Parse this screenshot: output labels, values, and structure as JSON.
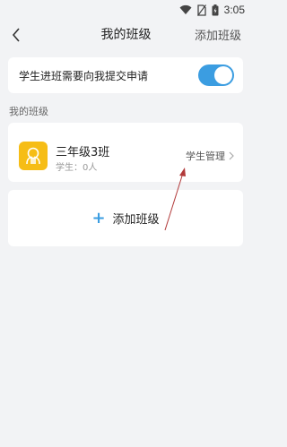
{
  "status_bar": {
    "time": "3:05",
    "icons": [
      "wifi-icon",
      "no-sim-icon",
      "battery-icon"
    ]
  },
  "header": {
    "title": "我的班级",
    "action_label": "添加班级",
    "back_icon": "chevron-left-icon"
  },
  "settings": {
    "join_approval_label": "学生进班需要向我提交申请",
    "join_approval_enabled": true
  },
  "section": {
    "title": "我的班级"
  },
  "classes": [
    {
      "name": "三年级3班",
      "student_count": "学生：0人",
      "manage_label": "学生管理",
      "avatar_icon": "class-logo-icon"
    }
  ],
  "add_class": {
    "label": "添加班级",
    "icon": "plus-icon"
  },
  "colors": {
    "accent": "#3b9de1",
    "avatar": "#f6bd16",
    "annotation_arrow": "#b23a3a"
  }
}
